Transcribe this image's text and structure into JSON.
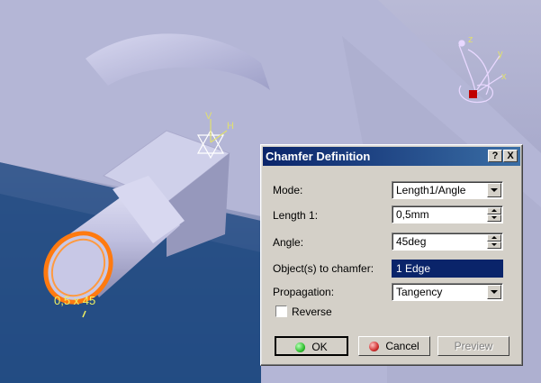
{
  "viewport": {
    "annotation_text": "0,5 x 45",
    "axis_labels": {
      "x": "x",
      "y": "y",
      "z": "z"
    },
    "point_axis_labels": {
      "v": "V",
      "h": "H"
    },
    "colors": {
      "background": "#b0b2d0",
      "model": "#c8c8e6",
      "selection": "#ff7a10",
      "annotation": "#f0f060",
      "compass": "#e0c8ff",
      "gradient_bottom": "#2a5a90"
    }
  },
  "dialog": {
    "title": "Chamfer Definition",
    "help_button": "?",
    "close_button": "X",
    "mode": {
      "label": "Mode:",
      "value": "Length1/Angle"
    },
    "length1": {
      "label": "Length 1:",
      "value": "0,5mm"
    },
    "angle": {
      "label": "Angle:",
      "value": "45deg"
    },
    "objects": {
      "label": "Object(s) to chamfer:",
      "value": "1 Edge"
    },
    "propagation": {
      "label": "Propagation:",
      "value": "Tangency"
    },
    "reverse": {
      "label": "Reverse",
      "checked": false
    },
    "ok_label": "OK",
    "cancel_label": "Cancel",
    "preview_label": "Preview",
    "colors": {
      "title_start": "#0a246a",
      "title_end": "#3a6ea5",
      "ok_led": "#30c030",
      "cancel_led": "#d03030"
    }
  }
}
